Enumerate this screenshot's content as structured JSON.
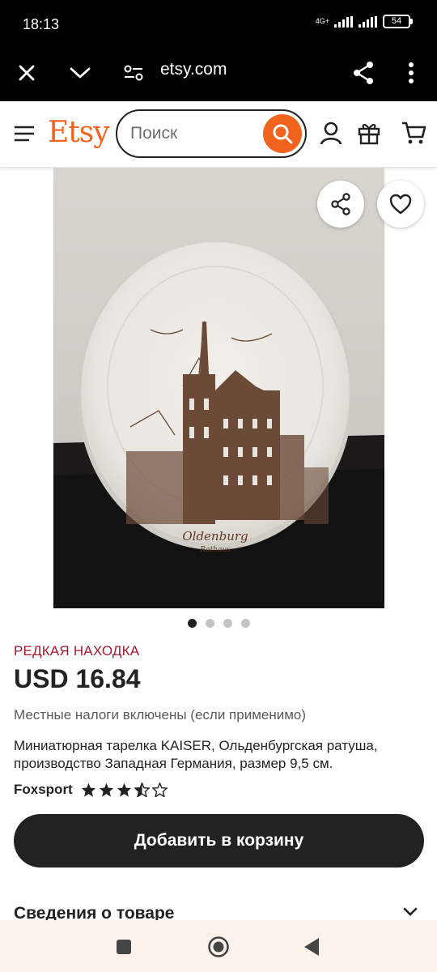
{
  "status_bar": {
    "time": "18:13",
    "network": "4G+",
    "battery": "54"
  },
  "browser": {
    "url": "etsy.com",
    "icons": [
      "close-icon",
      "chevron-down-icon",
      "site-settings-icon",
      "share-icon",
      "more-vert-icon"
    ]
  },
  "header": {
    "logo": "Etsy",
    "search_placeholder": "Поиск",
    "icons": [
      "menu-icon",
      "search-icon",
      "account-icon",
      "gift-icon",
      "cart-icon"
    ],
    "accent_color": "#f1641e"
  },
  "gallery": {
    "plate_text": "Oldenburg",
    "plate_subtext": "Rathaus",
    "dots_count": 4,
    "active_dot": 0
  },
  "product": {
    "badge": "РЕДКАЯ НАХОДКА",
    "badge_color": "#a61a2e",
    "price": "USD 16.84",
    "tax_note": "Местные налоги включены (если применимо)",
    "title": "Миниатюрная тарелка KAISER, Ольденбургская ратуша, производство Западная Германия, размер 9,5 см.",
    "seller": "Foxsport",
    "rating": 3.5,
    "rating_max": 5,
    "add_to_cart": "Добавить в корзину",
    "details_heading": "Сведения о товаре"
  },
  "nav_bar": {
    "icons": [
      "recents-icon",
      "home-icon",
      "back-icon"
    ]
  }
}
